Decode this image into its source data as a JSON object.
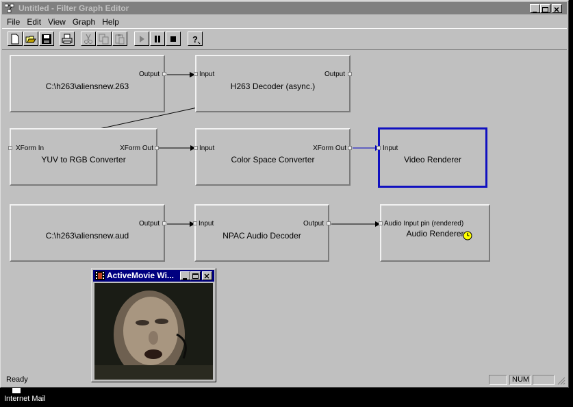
{
  "window": {
    "title": "Untitled - Filter Graph Editor"
  },
  "menu": [
    "File",
    "Edit",
    "View",
    "Graph",
    "Help"
  ],
  "toolbar": {
    "buttons": [
      "new-icon",
      "open-icon",
      "save-icon",
      "print-icon",
      "cut-icon",
      "copy-icon",
      "paste-icon",
      "play-icon",
      "pause-icon",
      "stop-icon",
      "help-icon"
    ]
  },
  "filters": {
    "src_video": {
      "name": "C:\\h263\\aliensnew.263",
      "out": "Output"
    },
    "h263": {
      "name": "H263 Decoder (async.)",
      "in": "Input",
      "out": "Output"
    },
    "yuv": {
      "name": "YUV to RGB Converter",
      "in": "XForm In",
      "out": "XForm Out"
    },
    "csc": {
      "name": "Color Space Converter",
      "in": "Input",
      "out": "XForm Out"
    },
    "video_renderer": {
      "name": "Video Renderer",
      "in": "Input"
    },
    "src_audio": {
      "name": "C:\\h263\\aliensnew.aud",
      "out": "Output"
    },
    "npac": {
      "name": "NPAC Audio Decoder",
      "in": "Input",
      "out": "Output"
    },
    "audio_renderer": {
      "name": "Audio Renderer",
      "in": "Audio Input pin (rendered)"
    }
  },
  "status": {
    "text": "Ready",
    "num": "NUM"
  },
  "child_window": {
    "title": "ActiveMovie Wi..."
  },
  "desktop": {
    "label": "Internet Mail"
  },
  "colors": {
    "selected_border": "#1010c0",
    "child_titlebar": "#000080",
    "inactive_titlebar": "#808080"
  }
}
